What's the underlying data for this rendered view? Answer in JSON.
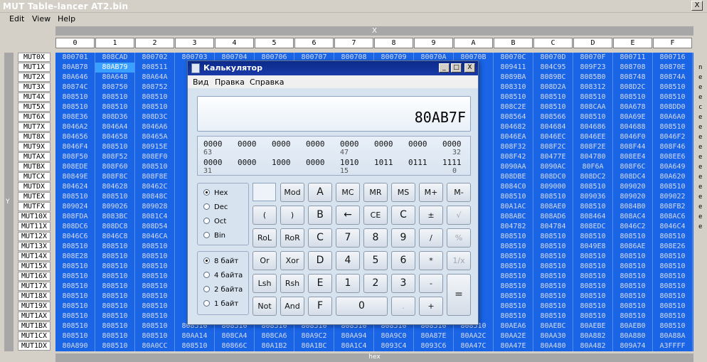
{
  "app": {
    "title": "MUT Table-lancer AT2.bin",
    "close_glyph": "X"
  },
  "menu": [
    "Edit",
    "View",
    "Help"
  ],
  "axis": {
    "x": "X",
    "y": "Y",
    "bottom": "hex"
  },
  "columns": [
    "0",
    "1",
    "2",
    "3",
    "4",
    "5",
    "6",
    "7",
    "8",
    "9",
    "A",
    "B",
    "C",
    "D",
    "E",
    "F"
  ],
  "rows": [
    "MUT0X",
    "MUT1X",
    "MUT2X",
    "MUT3X",
    "MUT4X",
    "MUT5X",
    "MUT6X",
    "MUT7X",
    "MUT8X",
    "MUT9X",
    "MUTAX",
    "MUTBX",
    "MUTCX",
    "MUTDX",
    "MUTEX",
    "MUTFX",
    "MUT10X",
    "MUT11X",
    "MUT12X",
    "MUT13X",
    "MUT14X",
    "MUT15X",
    "MUT16X",
    "MUT17X",
    "MUT18X",
    "MUT19X",
    "MUT1AX",
    "MUT1BX",
    "MUT1CX",
    "MUT1DX"
  ],
  "cells": [
    [
      "800701",
      "808CAD",
      "800702",
      "800703",
      "800704",
      "800706",
      "800707",
      "800708",
      "800709",
      "80070A",
      "80070B",
      "80070C",
      "80070D",
      "80070F",
      "800711",
      "800716"
    ],
    [
      "80AB78",
      "80AB79",
      "808511",
      "",
      "",
      "",
      "",
      "",
      "",
      "",
      "",
      "809411",
      "804C95",
      "809F23",
      "808708",
      "80870E"
    ],
    [
      "80A646",
      "80A648",
      "80A64A",
      "",
      "",
      "",
      "",
      "",
      "",
      "",
      "",
      "8089BA",
      "8089BC",
      "8085B0",
      "808748",
      "80874A"
    ],
    [
      "80874C",
      "808750",
      "808752",
      "",
      "",
      "",
      "",
      "",
      "",
      "",
      "",
      "808310",
      "808D2A",
      "808312",
      "808D2C",
      "808510"
    ],
    [
      "808510",
      "808510",
      "808510",
      "",
      "",
      "",
      "",
      "",
      "",
      "",
      "",
      "808510",
      "808510",
      "808510",
      "808510",
      "808510"
    ],
    [
      "808510",
      "808510",
      "808510",
      "",
      "",
      "",
      "",
      "",
      "",
      "",
      "",
      "808C2E",
      "808510",
      "808CAA",
      "80A678",
      "808DD0"
    ],
    [
      "808E36",
      "808D36",
      "808D3C",
      "",
      "",
      "",
      "",
      "",
      "",
      "",
      "",
      "808564",
      "808566",
      "808510",
      "80A69E",
      "80A6A0"
    ],
    [
      "8046A2",
      "8046A4",
      "8046A6",
      "",
      "",
      "",
      "",
      "",
      "",
      "",
      "",
      "804682",
      "804684",
      "804686",
      "804688",
      "808510"
    ],
    [
      "804656",
      "804658",
      "80465A",
      "",
      "",
      "",
      "",
      "",
      "",
      "",
      "",
      "8046EA",
      "8046EC",
      "8046EE",
      "8046F0",
      "8046F2"
    ],
    [
      "8046F4",
      "808510",
      "80915E",
      "",
      "",
      "",
      "",
      "",
      "",
      "",
      "",
      "808F32",
      "808F2C",
      "808F2E",
      "808F44",
      "808F46"
    ],
    [
      "808F50",
      "808F52",
      "808EF0",
      "",
      "",
      "",
      "",
      "",
      "",
      "",
      "",
      "808F42",
      "80477E",
      "804780",
      "808EE4",
      "808EE6"
    ],
    [
      "808EDE",
      "808F60",
      "808510",
      "",
      "",
      "",
      "",
      "",
      "",
      "",
      "",
      "8090AA",
      "8090AC",
      "80F6A",
      "808F6C",
      "80A649"
    ],
    [
      "80849E",
      "808F8C",
      "808F8E",
      "",
      "",
      "",
      "",
      "",
      "",
      "",
      "",
      "808DBE",
      "808DC0",
      "808DC2",
      "808DC4",
      "80A620"
    ],
    [
      "804624",
      "804628",
      "80462C",
      "",
      "",
      "",
      "",
      "",
      "",
      "",
      "",
      "8084C0",
      "809000",
      "808510",
      "809020",
      "808510"
    ],
    [
      "808510",
      "808510",
      "80848C",
      "",
      "",
      "",
      "",
      "",
      "",
      "",
      "",
      "808510",
      "808510",
      "809036",
      "809020",
      "809022"
    ],
    [
      "809024",
      "809026",
      "809028",
      "",
      "",
      "",
      "",
      "",
      "",
      "",
      "",
      "80A1AC",
      "808AE0",
      "808510",
      "8084B0",
      "808FB2"
    ],
    [
      "808FDA",
      "8083BC",
      "8081C4",
      "",
      "",
      "",
      "",
      "",
      "",
      "",
      "",
      "808ABC",
      "808AD6",
      "808464",
      "808AC4",
      "808AC6"
    ],
    [
      "808DC6",
      "808DC8",
      "808D54",
      "",
      "",
      "",
      "",
      "",
      "",
      "",
      "",
      "804782",
      "804784",
      "808EDC",
      "8046C2",
      "8046C4"
    ],
    [
      "8046C6",
      "8046C8",
      "8046CA",
      "",
      "",
      "",
      "",
      "",
      "",
      "",
      "",
      "808510",
      "808510",
      "808510",
      "808510",
      "808510"
    ],
    [
      "808510",
      "808510",
      "808510",
      "",
      "",
      "",
      "",
      "",
      "",
      "",
      "",
      "808510",
      "808510",
      "8049E8",
      "8086AE",
      "808E26"
    ],
    [
      "808E28",
      "808510",
      "808510",
      "",
      "",
      "",
      "",
      "",
      "",
      "",
      "",
      "808510",
      "808510",
      "808510",
      "808510",
      "808510"
    ],
    [
      "808510",
      "808510",
      "808510",
      "",
      "",
      "",
      "",
      "",
      "",
      "",
      "",
      "808510",
      "808510",
      "808510",
      "808510",
      "808510"
    ],
    [
      "808510",
      "808510",
      "808510",
      "",
      "",
      "",
      "",
      "",
      "",
      "",
      "",
      "808510",
      "808510",
      "808510",
      "808510",
      "808510"
    ],
    [
      "808510",
      "808510",
      "808510",
      "",
      "",
      "",
      "",
      "",
      "",
      "",
      "",
      "808510",
      "808510",
      "808510",
      "808510",
      "808510"
    ],
    [
      "808510",
      "808510",
      "808510",
      "",
      "",
      "",
      "",
      "",
      "",
      "",
      "",
      "808510",
      "808510",
      "808510",
      "808510",
      "808510"
    ],
    [
      "808510",
      "808510",
      "808510",
      "",
      "",
      "",
      "",
      "",
      "",
      "",
      "",
      "808510",
      "808510",
      "808510",
      "808510",
      "808510"
    ],
    [
      "808510",
      "808510",
      "808510",
      "",
      "",
      "",
      "",
      "",
      "",
      "",
      "",
      "808510",
      "808510",
      "808510",
      "808510",
      "808510"
    ],
    [
      "808510",
      "808510",
      "808510",
      "808510",
      "808510",
      "808510",
      "808510",
      "808510",
      "808510",
      "808510",
      "808510",
      "80AEA6",
      "80AEBC",
      "80AEBE",
      "80AEB0",
      "808510"
    ],
    [
      "808510",
      "808510",
      "808510",
      "80AA14",
      "808CA4",
      "808CA6",
      "80A9C2",
      "80AA94",
      "80A9C0",
      "80A87E",
      "80AA2C",
      "80AA2E",
      "80AA30",
      "80A882",
      "80A880",
      "80A88A"
    ],
    [
      "80A890",
      "808510",
      "80A0CC",
      "808510",
      "80866C",
      "80A1B2",
      "80A1BC",
      "80A1C4",
      "8093C4",
      "8093C6",
      "80A47C",
      "80A47E",
      "80A480",
      "80A482",
      "809A74",
      "A3FFFF"
    ]
  ],
  "selected_cell": {
    "row": 1,
    "col": 1
  },
  "right_edge": [
    "n",
    "e",
    "e",
    "e",
    "c",
    "e",
    "e",
    "e",
    "e",
    "e",
    "e",
    "e",
    "e",
    "e",
    "e",
    "e",
    "e"
  ],
  "calculator": {
    "title": "Калькулятор",
    "window_buttons": [
      "_",
      "□",
      "X"
    ],
    "menu": [
      "Вид",
      "Правка",
      "Справка"
    ],
    "display": "80AB7F",
    "bits_row1": [
      "0000",
      "0000",
      "0000",
      "0000",
      "0000",
      "0000",
      "0000",
      "0000"
    ],
    "bits_row1_pos": [
      "63",
      "47",
      "32"
    ],
    "bits_row2": [
      "0000",
      "0000",
      "1000",
      "0000",
      "1010",
      "1011",
      "0111",
      "1111"
    ],
    "bits_row2_pos": [
      "31",
      "15",
      "0"
    ],
    "base_options": [
      "Hex",
      "Dec",
      "Oct",
      "Bin"
    ],
    "size_options": [
      "8 байт",
      "4 байта",
      "2 байта",
      "1 байт"
    ],
    "buttons": [
      [
        "Mod",
        "A",
        "MC",
        "MR",
        "MS",
        "M+",
        "M-"
      ],
      [
        "(",
        ")",
        "B",
        "←",
        "CE",
        "C",
        "±",
        "√"
      ],
      [
        "RoL",
        "RoR",
        "C",
        "7",
        "8",
        "9",
        "/",
        "%"
      ],
      [
        "Or",
        "Xor",
        "D",
        "4",
        "5",
        "6",
        "*",
        "1/x"
      ],
      [
        "Lsh",
        "Rsh",
        "E",
        "1",
        "2",
        "3",
        "-",
        "="
      ],
      [
        "Not",
        "And",
        "F",
        "0",
        ".",
        "+"
      ]
    ]
  }
}
